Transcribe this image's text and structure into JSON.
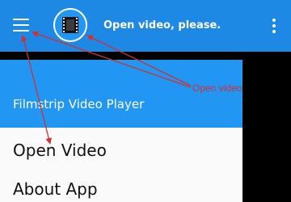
{
  "toolbar": {
    "title": "Open video, please.",
    "background": "#1e88e5",
    "menu_icon": "hamburger-menu-icon",
    "app_icon": "filmstrip-icon",
    "overflow_icon": "more-vert-icon"
  },
  "drawer": {
    "header_title": "Filmstrip Video Player",
    "header_color": "#2196f3",
    "items": [
      {
        "label": "Open Video"
      },
      {
        "label": "About App"
      }
    ]
  },
  "annotation": {
    "label": "Open video",
    "color": "#d32f2f"
  }
}
